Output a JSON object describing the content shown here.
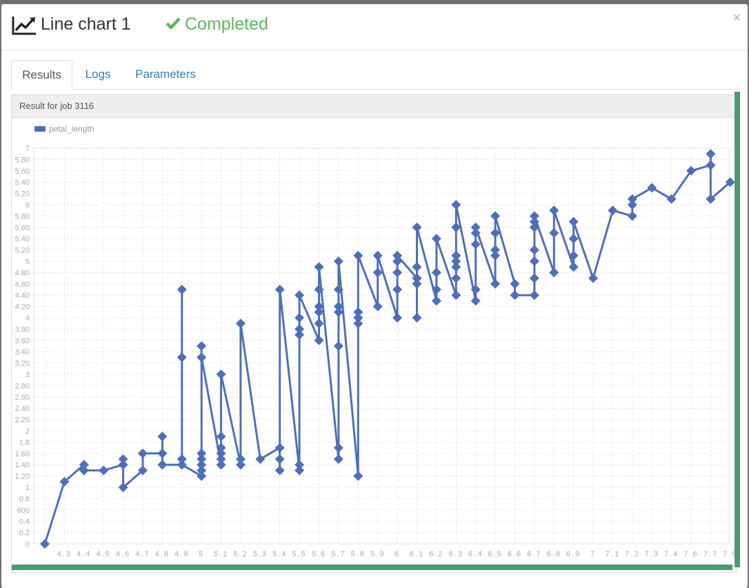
{
  "header": {
    "title": "Line chart 1",
    "status": "Completed",
    "close_label": "×",
    "title_icon": "line-chart-icon",
    "status_icon": "check-icon"
  },
  "tabs": [
    {
      "label": "Results",
      "active": true
    },
    {
      "label": "Logs",
      "active": false
    },
    {
      "label": "Parameters",
      "active": false
    }
  ],
  "panel": {
    "heading": "Result for job 3116"
  },
  "colors": {
    "series": "#4e6fb8",
    "status": "#5cb85c",
    "accent_bar": "#4a9a6e",
    "link": "#337ab7"
  },
  "chart_data": {
    "type": "line",
    "title": "",
    "xlabel": "",
    "ylabel": "",
    "grid": true,
    "legend": "top-left",
    "ylim": [
      0,
      7
    ],
    "categories": [
      "",
      "4.3",
      "4.4",
      "4.5",
      "4.6",
      "4.7",
      "4.8",
      "4.9",
      "5",
      "5.1",
      "5.2",
      "5.3",
      "5.4",
      "5.5",
      "5.6",
      "5.7",
      "5.8",
      "5.9",
      "6",
      "6.1",
      "6.2",
      "6.3",
      "6.4",
      "6.5",
      "6.6",
      "6.7",
      "6.8",
      "6.9",
      "7",
      "7.1",
      "7.2",
      "7.3",
      "7.4",
      "7.6",
      "7.7",
      "7.9"
    ],
    "y_ticks": [
      "0",
      "0.20",
      "0.40",
      "0.60",
      "0.80",
      "1",
      "1.20",
      "1.40",
      "1.60",
      "1.80",
      "2",
      "2.20",
      "2.40",
      "2.60",
      "2.80",
      "3",
      "3.20",
      "3.40",
      "3.60",
      "3.80",
      "4",
      "4.20",
      "4.40",
      "4.60",
      "4.80",
      "5",
      "5.20",
      "5.40",
      "5.60",
      "5.80",
      "6",
      "6.20",
      "6.40",
      "6.60",
      "6.80",
      "7"
    ],
    "y_tick_labels": [
      "0",
      "0.2",
      "0.4",
      "600",
      "0.8",
      "1",
      "1.20",
      "1.40",
      "1.60",
      "1.8",
      "2",
      "2.20",
      "2.40",
      "2.60",
      "2.80",
      "3",
      "3.20",
      "3.40",
      "3.60",
      "3.80",
      "4",
      "4.20",
      "4.40",
      "4.60",
      "4.80",
      "5",
      "5.20",
      "5.40",
      "5.60",
      "5.80",
      "6",
      "5.20",
      "5.40",
      "5.60",
      "5.80",
      "7"
    ],
    "series": [
      {
        "name": "petal_length",
        "points": [
          [
            "",
            0
          ],
          [
            "4.3",
            1.1
          ],
          [
            "4.4",
            1.4
          ],
          [
            "4.4",
            1.3
          ],
          [
            "4.5",
            1.3
          ],
          [
            "4.6",
            1.4
          ],
          [
            "4.6",
            1.5
          ],
          [
            "4.6",
            1.4
          ],
          [
            "4.6",
            1.0
          ],
          [
            "4.7",
            1.3
          ],
          [
            "4.7",
            1.6
          ],
          [
            "4.8",
            1.6
          ],
          [
            "4.8",
            1.9
          ],
          [
            "4.8",
            1.6
          ],
          [
            "4.8",
            1.4
          ],
          [
            "4.9",
            1.4
          ],
          [
            "4.9",
            1.5
          ],
          [
            "4.9",
            4.5
          ],
          [
            "4.9",
            3.3
          ],
          [
            "4.9",
            1.4
          ],
          [
            "5",
            1.2
          ],
          [
            "5",
            1.3
          ],
          [
            "5",
            1.4
          ],
          [
            "5",
            1.5
          ],
          [
            "5",
            1.6
          ],
          [
            "5",
            3.5
          ],
          [
            "5",
            3.3
          ],
          [
            "5.1",
            1.4
          ],
          [
            "5.1",
            1.5
          ],
          [
            "5.1",
            1.6
          ],
          [
            "5.1",
            1.7
          ],
          [
            "5.1",
            1.9
          ],
          [
            "5.1",
            3.0
          ],
          [
            "5.2",
            1.4
          ],
          [
            "5.2",
            1.5
          ],
          [
            "5.2",
            3.9
          ],
          [
            "5.3",
            1.5
          ],
          [
            "5.4",
            1.7
          ],
          [
            "5.4",
            1.3
          ],
          [
            "5.4",
            1.5
          ],
          [
            "5.4",
            4.5
          ],
          [
            "5.5",
            1.3
          ],
          [
            "5.5",
            1.4
          ],
          [
            "5.5",
            3.7
          ],
          [
            "5.5",
            3.8
          ],
          [
            "5.5",
            4.0
          ],
          [
            "5.5",
            4.4
          ],
          [
            "5.6",
            3.6
          ],
          [
            "5.6",
            3.9
          ],
          [
            "5.6",
            4.1
          ],
          [
            "5.6",
            4.2
          ],
          [
            "5.6",
            4.5
          ],
          [
            "5.6",
            4.9
          ],
          [
            "5.7",
            1.5
          ],
          [
            "5.7",
            1.7
          ],
          [
            "5.7",
            3.5
          ],
          [
            "5.7",
            4.1
          ],
          [
            "5.7",
            4.2
          ],
          [
            "5.7",
            4.5
          ],
          [
            "5.7",
            5.0
          ],
          [
            "5.8",
            1.2
          ],
          [
            "5.8",
            3.9
          ],
          [
            "5.8",
            4.0
          ],
          [
            "5.8",
            4.1
          ],
          [
            "5.8",
            5.1
          ],
          [
            "5.9",
            4.2
          ],
          [
            "5.9",
            4.8
          ],
          [
            "5.9",
            5.1
          ],
          [
            "6",
            4.0
          ],
          [
            "6",
            4.5
          ],
          [
            "6",
            4.8
          ],
          [
            "6",
            5.0
          ],
          [
            "6",
            5.1
          ],
          [
            "6.1",
            4.7
          ],
          [
            "6.1",
            4.0
          ],
          [
            "6.1",
            4.6
          ],
          [
            "6.1",
            4.7
          ],
          [
            "6.1",
            4.9
          ],
          [
            "6.1",
            5.6
          ],
          [
            "6.2",
            4.3
          ],
          [
            "6.2",
            4.5
          ],
          [
            "6.2",
            4.8
          ],
          [
            "6.2",
            5.4
          ],
          [
            "6.3",
            4.4
          ],
          [
            "6.3",
            4.7
          ],
          [
            "6.3",
            4.9
          ],
          [
            "6.3",
            5.0
          ],
          [
            "6.3",
            5.1
          ],
          [
            "6.3",
            5.6
          ],
          [
            "6.3",
            6.0
          ],
          [
            "6.4",
            4.3
          ],
          [
            "6.4",
            4.5
          ],
          [
            "6.4",
            5.3
          ],
          [
            "6.4",
            5.5
          ],
          [
            "6.4",
            5.6
          ],
          [
            "6.5",
            4.6
          ],
          [
            "6.5",
            5.1
          ],
          [
            "6.5",
            5.2
          ],
          [
            "6.5",
            5.5
          ],
          [
            "6.5",
            5.8
          ],
          [
            "6.6",
            4.6
          ],
          [
            "6.6",
            4.4
          ],
          [
            "6.7",
            4.4
          ],
          [
            "6.7",
            4.7
          ],
          [
            "6.7",
            5.0
          ],
          [
            "6.7",
            5.2
          ],
          [
            "6.7",
            5.6
          ],
          [
            "6.7",
            5.7
          ],
          [
            "6.7",
            5.8
          ],
          [
            "6.8",
            4.8
          ],
          [
            "6.8",
            5.5
          ],
          [
            "6.8",
            5.9
          ],
          [
            "6.9",
            4.9
          ],
          [
            "6.9",
            5.1
          ],
          [
            "6.9",
            5.4
          ],
          [
            "6.9",
            5.7
          ],
          [
            "7",
            4.7
          ],
          [
            "7.1",
            5.9
          ],
          [
            "7.2",
            5.8
          ],
          [
            "7.2",
            6.0
          ],
          [
            "7.2",
            6.1
          ],
          [
            "7.3",
            6.3
          ],
          [
            "7.4",
            6.1
          ],
          [
            "7.6",
            6.6
          ],
          [
            "7.7",
            6.7
          ],
          [
            "7.7",
            6.9
          ],
          [
            "7.7",
            6.7
          ],
          [
            "7.7",
            6.1
          ],
          [
            "7.9",
            6.4
          ]
        ]
      }
    ]
  }
}
